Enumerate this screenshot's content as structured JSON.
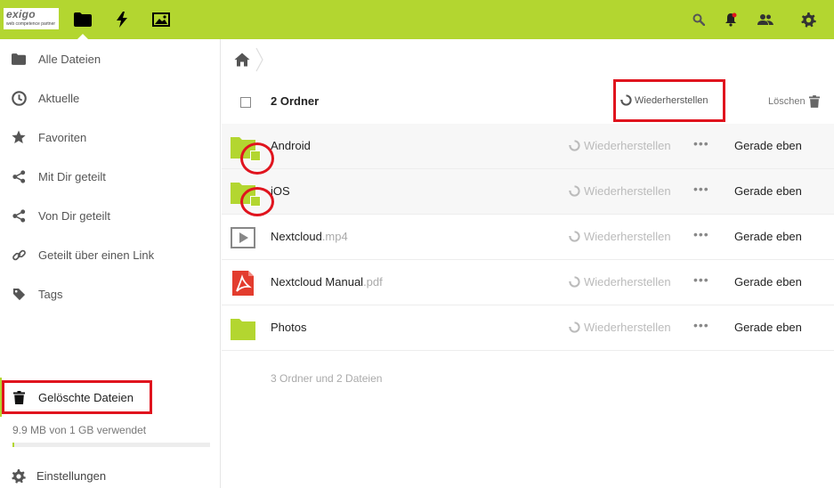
{
  "header": {
    "logo_main": "exigo",
    "logo_sub": "web competence partner",
    "apps": [
      "folder-icon",
      "lightning-icon",
      "image-icon"
    ],
    "right_icons": [
      "search-icon",
      "bell-icon",
      "contacts-icon",
      "gear-icon"
    ],
    "brand_color": "#b3d630"
  },
  "sidebar": {
    "items": [
      {
        "label": "Alle Dateien",
        "icon": "folder-icon"
      },
      {
        "label": "Aktuelle",
        "icon": "clock-icon"
      },
      {
        "label": "Favoriten",
        "icon": "star-icon"
      },
      {
        "label": "Mit Dir geteilt",
        "icon": "share-icon"
      },
      {
        "label": "Von Dir geteilt",
        "icon": "share-icon"
      },
      {
        "label": "Geteilt über einen Link",
        "icon": "link-icon"
      },
      {
        "label": "Tags",
        "icon": "tag-icon"
      }
    ],
    "deleted": {
      "label": "Gelöschte Dateien",
      "icon": "trash-icon"
    },
    "quota": {
      "text": "9.9 MB von 1 GB verwendet",
      "used_fraction": 0.0099
    },
    "settings": {
      "label": "Einstellungen",
      "icon": "gear-icon"
    }
  },
  "breadcrumb": {
    "home_icon": "home-icon"
  },
  "list": {
    "selection_label": "2 Ordner",
    "restore_label": "Wiederherstellen",
    "delete_label": "Löschen",
    "rows": [
      {
        "name": "Android",
        "ext": "",
        "type": "folder",
        "selected": true,
        "restore": "Wiederherstellen",
        "date": "Gerade eben"
      },
      {
        "name": "iOS",
        "ext": "",
        "type": "folder",
        "selected": true,
        "restore": "Wiederherstellen",
        "date": "Gerade eben"
      },
      {
        "name": "Nextcloud",
        "ext": ".mp4",
        "type": "video",
        "selected": false,
        "restore": "Wiederherstellen",
        "date": "Gerade eben"
      },
      {
        "name": "Nextcloud Manual",
        "ext": ".pdf",
        "type": "pdf",
        "selected": false,
        "restore": "Wiederherstellen",
        "date": "Gerade eben"
      },
      {
        "name": "Photos",
        "ext": "",
        "type": "folder",
        "selected": false,
        "restore": "Wiederherstellen",
        "date": "Gerade eben"
      }
    ],
    "summary": "3 Ordner und 2 Dateien"
  },
  "colors": {
    "highlight": "#e0141e",
    "folder": "#b3d630",
    "pdf": "#e33c2e"
  }
}
